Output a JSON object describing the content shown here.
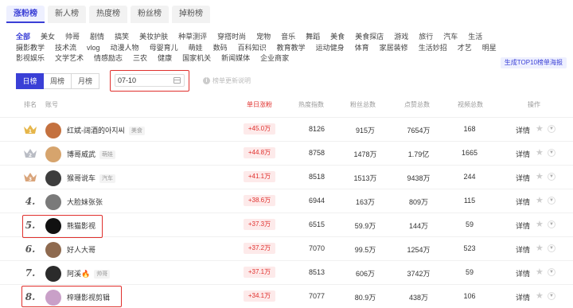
{
  "top_tabs": [
    "涨粉榜",
    "新人榜",
    "热度榜",
    "粉丝榜",
    "掉粉榜"
  ],
  "categories_row1": [
    "全部",
    "美女",
    "帅哥",
    "剧情",
    "搞笑",
    "美妆护肤",
    "种草测评",
    "穿搭时尚",
    "宠物",
    "音乐",
    "舞蹈",
    "美食",
    "美食探店",
    "游戏",
    "旅行",
    "汽车",
    "生活"
  ],
  "categories_row2": [
    "摄影教学",
    "技术流",
    "vlog",
    "动漫人物",
    "母婴育儿",
    "萌娃",
    "数码",
    "百科知识",
    "教育教学",
    "运动健身",
    "体育",
    "家居装修",
    "生活妙招",
    "才艺",
    "明星"
  ],
  "categories_row3": [
    "影视娱乐",
    "文学艺术",
    "情感励志",
    "三农",
    "健康",
    "国家机关",
    "新闻媒体",
    "企业商家"
  ],
  "promo": "生成TOP10榜单海报",
  "period": [
    "日榜",
    "周榜",
    "月榜"
  ],
  "date_value": "07-10",
  "hint": "榜单更新说明",
  "columns": {
    "rank": "排名",
    "account": "账号",
    "daily_gain": "单日涨粉",
    "heat": "热度指数",
    "fans": "粉丝总数",
    "likes": "点赞总数",
    "videos": "视频总数",
    "ops": "操作"
  },
  "colors": {
    "accent": "#3a3fd6",
    "highlight": "#e0302d",
    "gold": "#e6b64a",
    "silver": "#b9bcc4",
    "bronze": "#d9a47a"
  },
  "rows": [
    {
      "rank": "1",
      "name": "红斌-阔酒的아지씨",
      "tag": "美食",
      "gain": "+45.0万",
      "heat": "8126",
      "fans": "915万",
      "likes": "7654万",
      "videos": "168",
      "detail": "详情",
      "avatar": "#c4713f"
    },
    {
      "rank": "2",
      "name": "博哥威武",
      "tag": "萌娃",
      "gain": "+44.8万",
      "heat": "8758",
      "fans": "1478万",
      "likes": "1.79亿",
      "videos": "1665",
      "detail": "详情",
      "avatar": "#d6a46d"
    },
    {
      "rank": "3",
      "name": "猴哥说车",
      "tag": "汽车",
      "gain": "+41.1万",
      "heat": "8518",
      "fans": "1513万",
      "likes": "9438万",
      "videos": "244",
      "detail": "详情",
      "avatar": "#3d3d3d"
    },
    {
      "rank": "4.",
      "name": "大脸妹张张",
      "tag": "",
      "gain": "+38.6万",
      "heat": "6944",
      "fans": "163万",
      "likes": "809万",
      "videos": "115",
      "detail": "详情",
      "avatar": "#7a7a7a"
    },
    {
      "rank": "5.",
      "name": "熊猫影视",
      "tag": "",
      "gain": "+37.3万",
      "heat": "6515",
      "fans": "59.9万",
      "likes": "144万",
      "videos": "59",
      "detail": "详情",
      "avatar": "#111111"
    },
    {
      "rank": "6.",
      "name": "好人大哥",
      "tag": "",
      "gain": "+37.2万",
      "heat": "7070",
      "fans": "99.5万",
      "likes": "1254万",
      "videos": "523",
      "detail": "详情",
      "avatar": "#8e6a4f"
    },
    {
      "rank": "7.",
      "name": "阿溪🔥",
      "tag": "帅哥",
      "gain": "+37.1万",
      "heat": "8513",
      "fans": "606万",
      "likes": "3742万",
      "videos": "59",
      "detail": "详情",
      "avatar": "#2b2b2b"
    },
    {
      "rank": "8.",
      "name": "梓珊影视剪辑",
      "tag": "",
      "gain": "+34.1万",
      "heat": "7077",
      "fans": "80.9万",
      "likes": "438万",
      "videos": "106",
      "detail": "详情",
      "avatar": "#c9a0c8"
    }
  ]
}
